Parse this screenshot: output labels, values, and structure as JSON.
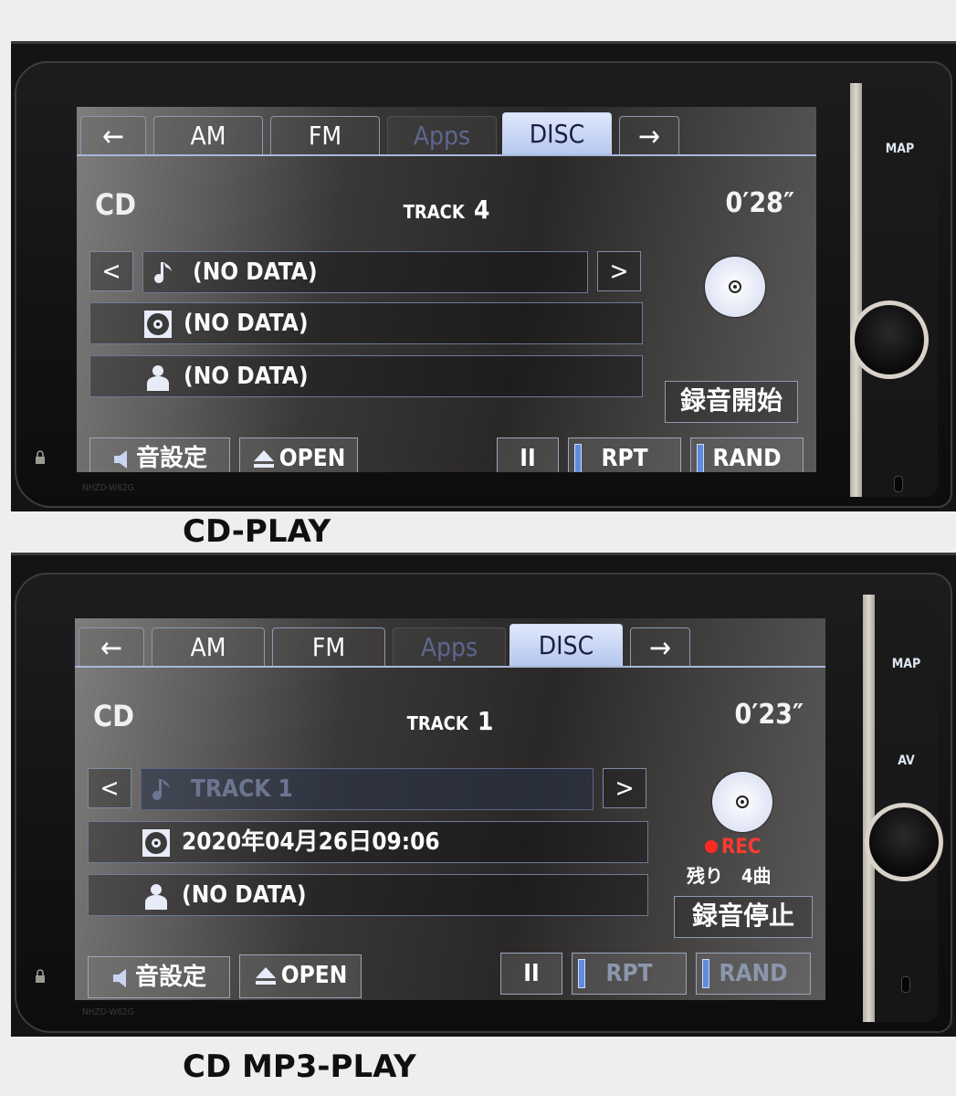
{
  "captions": {
    "top": "CD-PLAY",
    "bottom": "CD MP3-PLAY"
  },
  "units": [
    {
      "tabs": [
        {
          "label": "←",
          "icon": "arrow-left-icon"
        },
        {
          "label": "AM"
        },
        {
          "label": "FM"
        },
        {
          "label": "Apps",
          "state": "disabled"
        },
        {
          "label": "DISC",
          "state": "active"
        },
        {
          "label": "→",
          "icon": "arrow-right-icon"
        }
      ],
      "source": "CD",
      "track_label": "TRACK",
      "track_number": "4",
      "time": "0′28″",
      "prev_label": "<",
      "next_label": ">",
      "rows": [
        {
          "icon": "music-note-icon",
          "text": "(NO DATA)"
        },
        {
          "icon": "disc-album-icon",
          "text": "(NO DATA)"
        },
        {
          "icon": "artist-person-icon",
          "text": "(NO DATA)"
        }
      ],
      "record_button": "録音開始",
      "bottom": {
        "sound": "音設定",
        "open": "OPEN",
        "pause": "II",
        "rpt": "RPT",
        "rand": "RAND"
      },
      "side": {
        "map": "MAP"
      },
      "model": "NHZD-W62G"
    },
    {
      "tabs": [
        {
          "label": "←",
          "icon": "arrow-left-icon"
        },
        {
          "label": "AM"
        },
        {
          "label": "FM"
        },
        {
          "label": "Apps",
          "state": "disabled"
        },
        {
          "label": "DISC",
          "state": "active"
        },
        {
          "label": "→",
          "icon": "arrow-right-icon"
        }
      ],
      "source": "CD",
      "track_label": "TRACK",
      "track_number": "1",
      "time": "0′23″",
      "prev_label": "<",
      "next_label": ">",
      "rows": [
        {
          "icon": "music-note-icon",
          "text": "TRACK  1",
          "state": "dim"
        },
        {
          "icon": "disc-album-icon",
          "text": "2020年04月26日09:06"
        },
        {
          "icon": "artist-person-icon",
          "text": "(NO DATA)"
        }
      ],
      "rec_label": "REC",
      "remaining": "残り　4曲",
      "record_button": "録音停止",
      "bottom": {
        "sound": "音設定",
        "open": "OPEN",
        "pause": "II",
        "rpt": "RPT",
        "rand": "RAND",
        "rpt_state": "disabled",
        "rand_state": "disabled"
      },
      "side": {
        "map": "MAP",
        "av": "AV"
      },
      "model": "NHZD-W62G"
    }
  ],
  "colors": {
    "active_tab": "#c8d6f2",
    "indicator": "#5e8ce0",
    "rec_red": "#ff2a20",
    "dim_text": "#6c7590"
  }
}
